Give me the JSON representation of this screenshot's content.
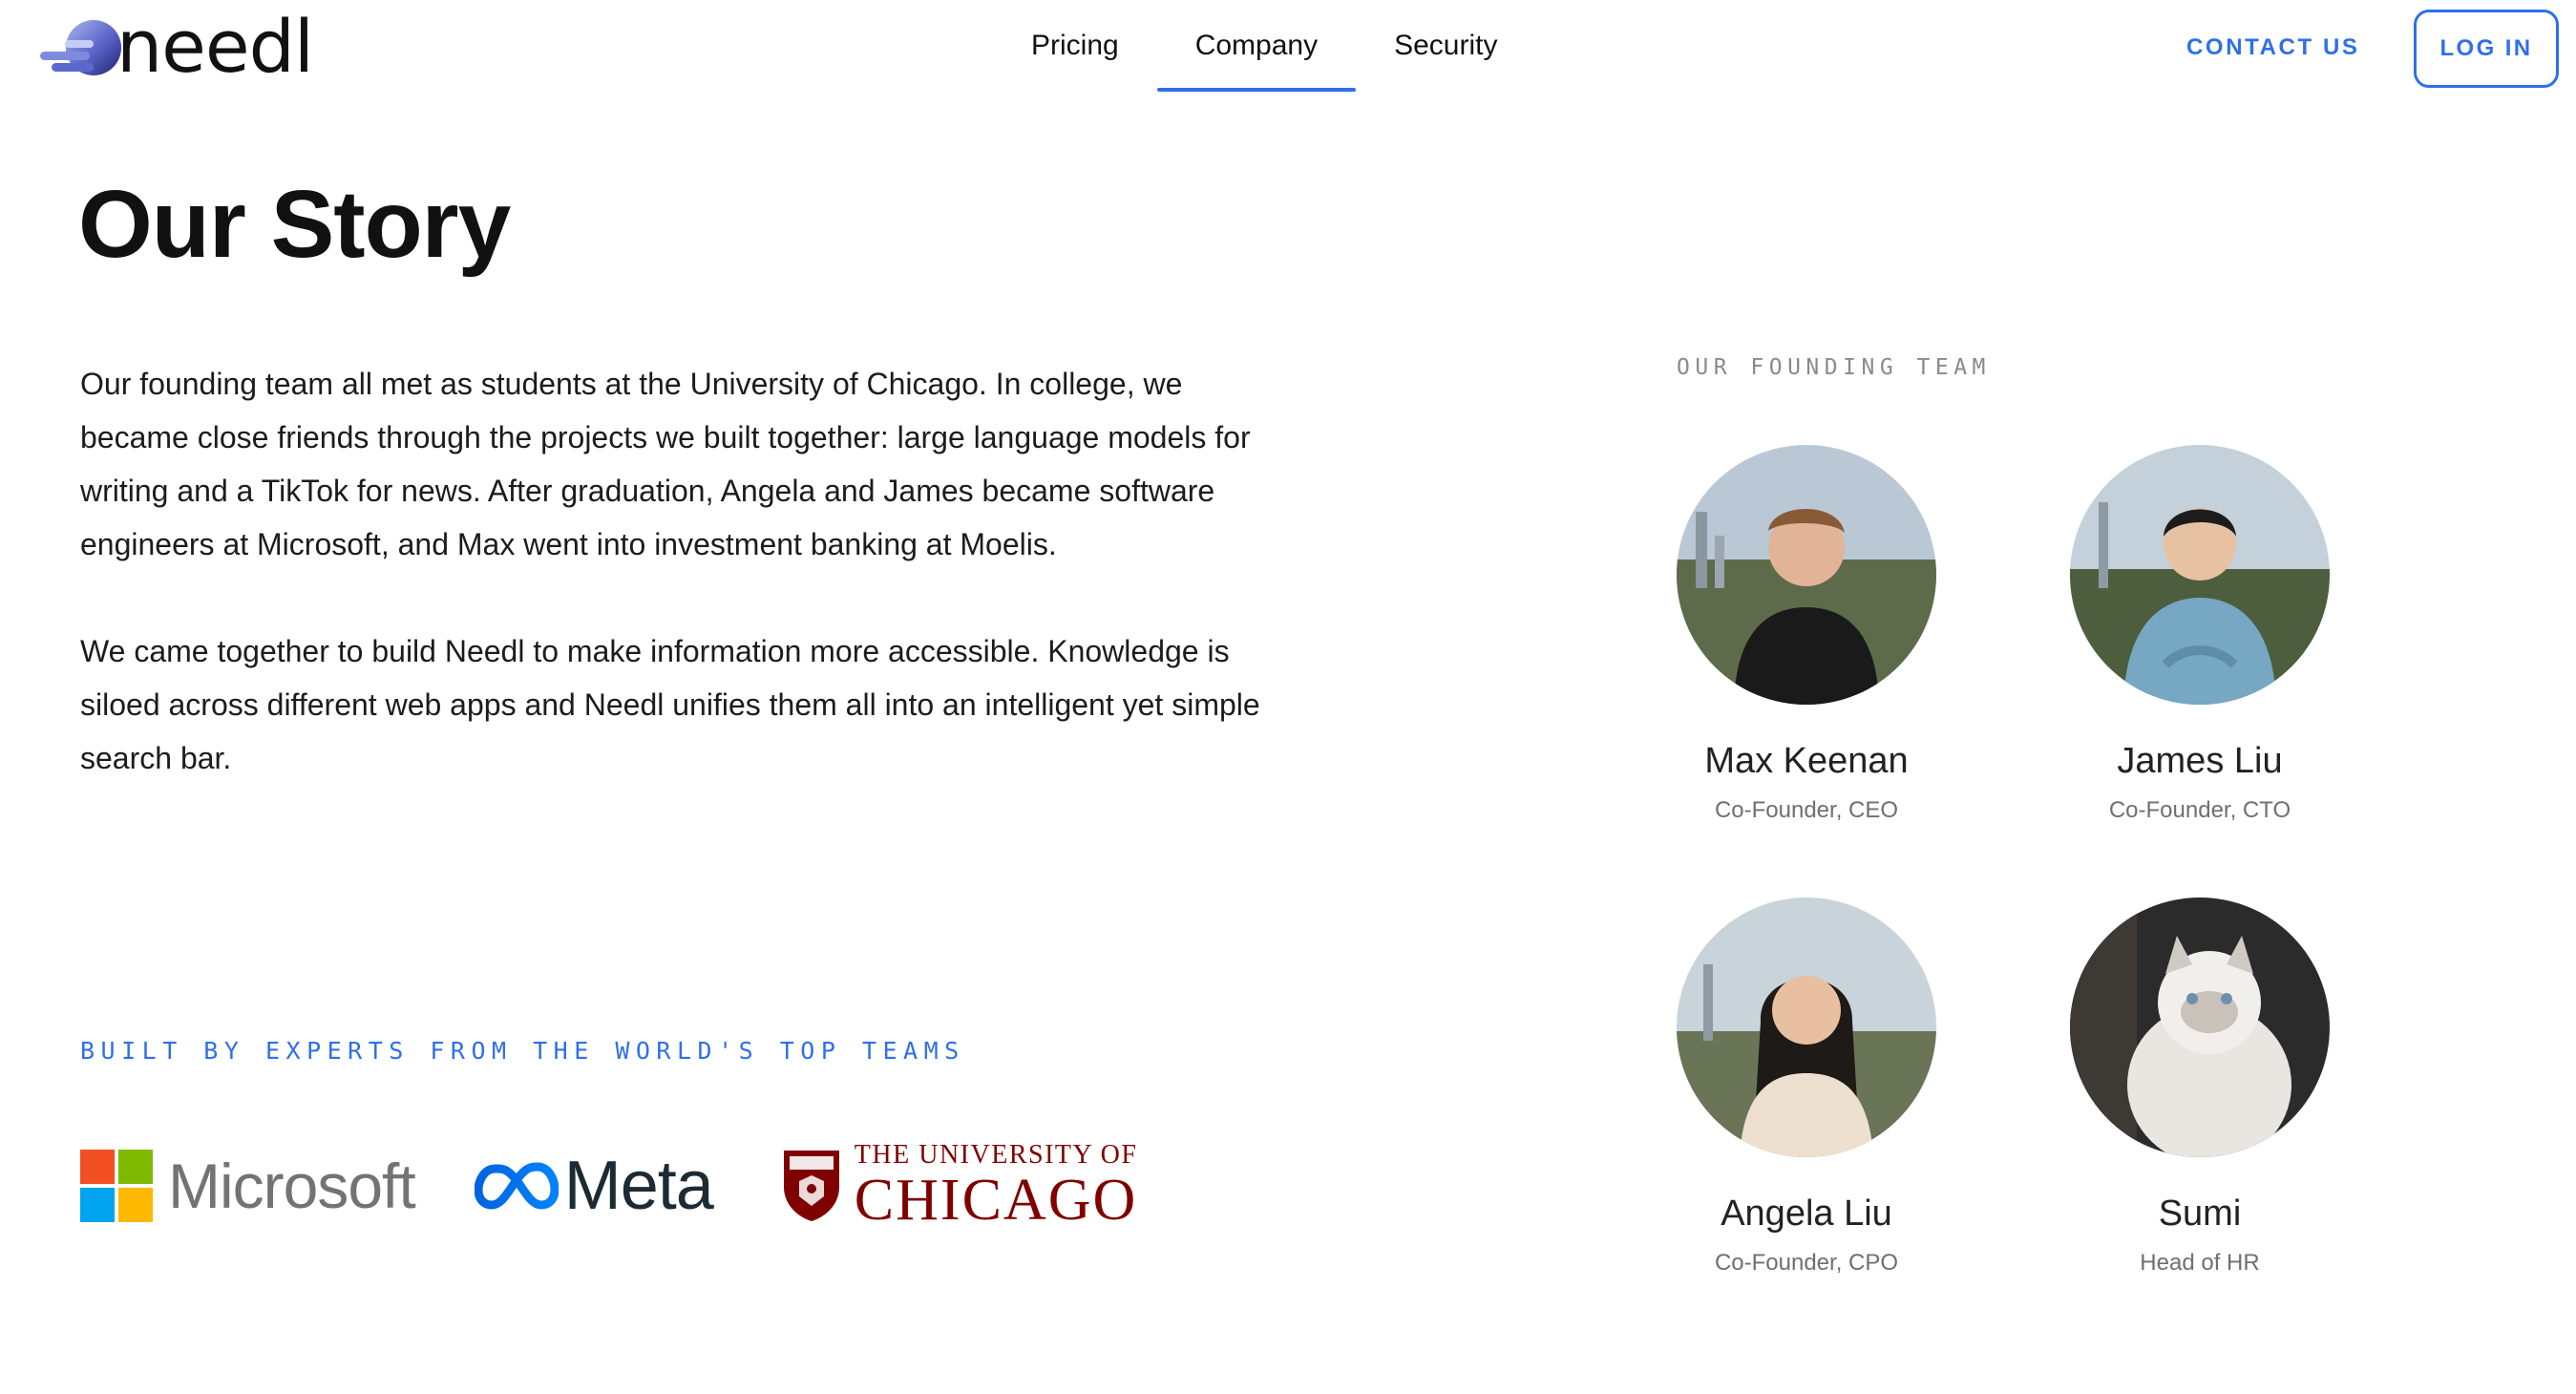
{
  "brand": {
    "name": "needl",
    "accent": "#2f6fea"
  },
  "nav": {
    "items": [
      {
        "label": "Pricing",
        "active": false
      },
      {
        "label": "Company",
        "active": true
      },
      {
        "label": "Security",
        "active": false
      }
    ]
  },
  "header": {
    "contact_label": "CONTACT US",
    "login_label": "LOG IN"
  },
  "page": {
    "title": "Our Story",
    "paragraphs": [
      "Our founding team all met as students at the University of Chicago. In college, we became close friends through the projects we built together: large language models for writing and a TikTok for news. After graduation, Angela and James became software engineers at Microsoft, and Max went into investment banking at Moelis.",
      "We came together to build Needl to make information more accessible. Knowledge is siloed across different web apps and Needl unifies them all into an intelligent yet simple search bar."
    ]
  },
  "experts": {
    "label": "BUILT BY EXPERTS FROM THE WORLD'S TOP TEAMS",
    "logos": [
      {
        "name": "Microsoft",
        "text": "Microsoft"
      },
      {
        "name": "Meta",
        "text": "Meta"
      },
      {
        "name": "University of Chicago",
        "line1": "THE UNIVERSITY OF",
        "line2": "CHICAGO"
      }
    ]
  },
  "team": {
    "label": "OUR FOUNDING TEAM",
    "members": [
      {
        "name": "Max Keenan",
        "role": "Co-Founder, CEO"
      },
      {
        "name": "James Liu",
        "role": "Co-Founder, CTO"
      },
      {
        "name": "Angela Liu",
        "role": "Co-Founder, CPO"
      },
      {
        "name": "Sumi",
        "role": "Head of HR"
      }
    ]
  }
}
